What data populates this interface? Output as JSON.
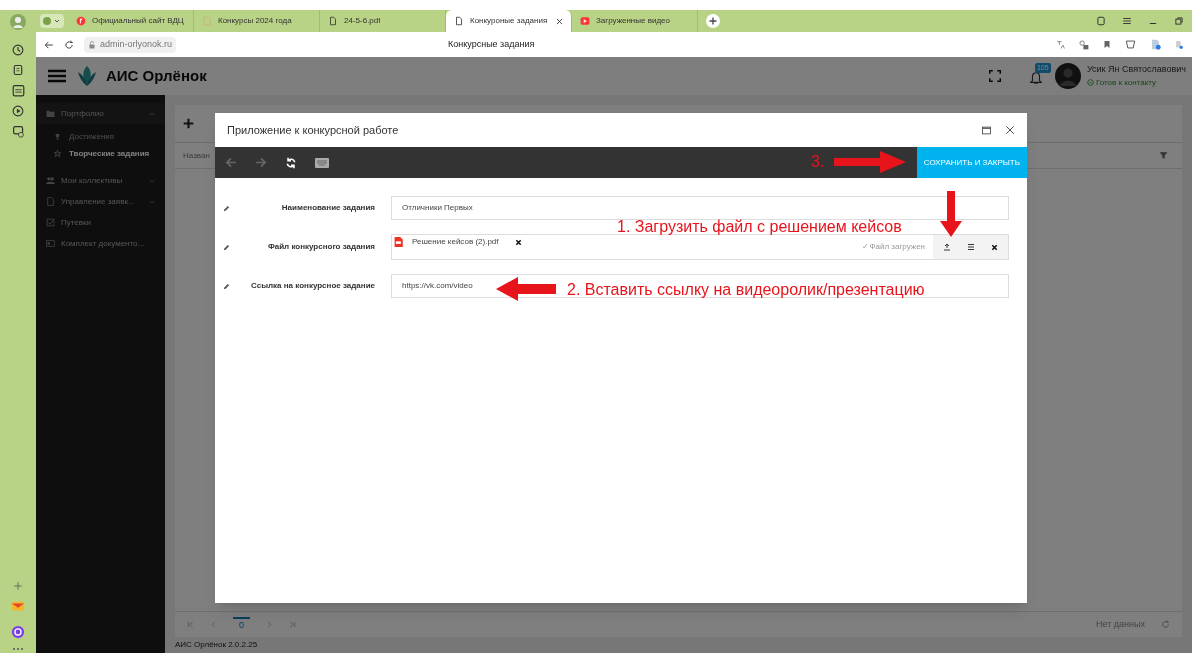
{
  "browser": {
    "tabs": [
      {
        "title": "Официальный сайт ВДЦ",
        "kind": "yandex",
        "selected": false
      },
      {
        "title": "Конкурсы 2024 года",
        "kind": "book",
        "selected": false
      },
      {
        "title": "24-5-6.pdf",
        "kind": "doc",
        "selected": false
      },
      {
        "title": "Конкуроные задания",
        "kind": "doc",
        "selected": true
      },
      {
        "title": "Загруженные видео",
        "kind": "video",
        "selected": false
      }
    ],
    "address": "admin-orlyonok.ru",
    "page_title": "Конкурсные задания"
  },
  "header": {
    "app_name": "АИС Орлёнок",
    "notifications": "105",
    "user_name": "Усик Ян Святославович",
    "user_status": "Готов к контакту"
  },
  "sidebar": {
    "items": [
      {
        "label": "Портфолио",
        "expanded": true,
        "children": [
          {
            "label": "Достижения",
            "selected": false
          },
          {
            "label": "Творческие задания",
            "selected": true
          }
        ]
      },
      {
        "label": "Мои коллективы",
        "expanded": false
      },
      {
        "label": "Управление заявк...",
        "expanded": false
      },
      {
        "label": "Путевки"
      },
      {
        "label": "Комплект документо..."
      }
    ]
  },
  "content": {
    "column_1": "Назван",
    "pager_page": "0",
    "empty_text": "Нет данных",
    "version": "АИС Орлёнок 2.0.2.25"
  },
  "modal": {
    "title": "Приложение к конкурсной работе",
    "save_button": "СОХРАНИТЬ И ЗАКРЫТЬ",
    "fields": [
      {
        "kind": "text",
        "label": "Наименование задания",
        "value": "Отличники Первых"
      },
      {
        "kind": "file",
        "label": "Файл конкурсного задания",
        "file_name": "Решение кейсов (2).pdf",
        "status": "✓Файл загружен"
      },
      {
        "kind": "text",
        "label": "Ссылка на конкурсное задание",
        "value": "https://vk.com/video"
      }
    ]
  },
  "annotations": [
    {
      "kind": "down",
      "text": "1. Загрузить файл с решением кейсов"
    },
    {
      "kind": "left",
      "text": "2. Вставить ссылку на видеоролик/презентацию"
    },
    {
      "kind": "right",
      "text": "3."
    }
  ]
}
